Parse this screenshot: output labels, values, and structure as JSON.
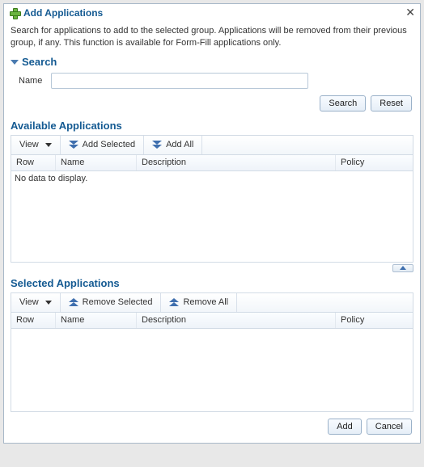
{
  "dialog": {
    "title": "Add Applications",
    "description": "Search for applications to add to the selected group. Applications will be removed from their previous group, if any. This function is available for Form-Fill applications only."
  },
  "search": {
    "heading": "Search",
    "name_label": "Name",
    "name_value": "",
    "search_btn": "Search",
    "reset_btn": "Reset"
  },
  "available": {
    "heading": "Available Applications",
    "view_label": "View",
    "add_selected": "Add Selected",
    "add_all": "Add All",
    "columns": {
      "row": "Row",
      "name": "Name",
      "description": "Description",
      "policy": "Policy"
    },
    "empty_text": "No data to display."
  },
  "selected": {
    "heading": "Selected Applications",
    "view_label": "View",
    "remove_selected": "Remove Selected",
    "remove_all": "Remove All",
    "columns": {
      "row": "Row",
      "name": "Name",
      "description": "Description",
      "policy": "Policy"
    }
  },
  "footer": {
    "add": "Add",
    "cancel": "Cancel"
  }
}
